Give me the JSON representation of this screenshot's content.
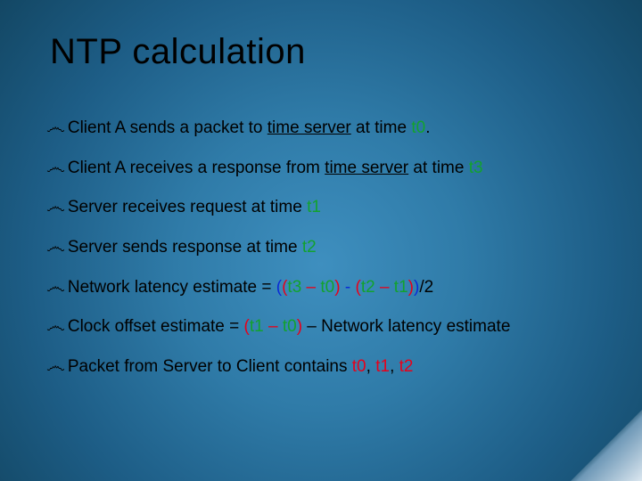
{
  "title": "NTP calculation",
  "bullets": [
    {
      "segments": [
        {
          "text": "Client A sends a packet to ",
          "cls": ""
        },
        {
          "text": "time server",
          "cls": "underline"
        },
        {
          "text": " at time ",
          "cls": ""
        },
        {
          "text": "t0",
          "cls": "hl-green"
        },
        {
          "text": ".",
          "cls": ""
        }
      ]
    },
    {
      "segments": [
        {
          "text": "Client A receives a response from ",
          "cls": ""
        },
        {
          "text": "time server",
          "cls": "underline"
        },
        {
          "text": " at time ",
          "cls": ""
        },
        {
          "text": "t3",
          "cls": "hl-green"
        }
      ]
    },
    {
      "segments": [
        {
          "text": "Server receives request at time ",
          "cls": ""
        },
        {
          "text": "t1",
          "cls": "hl-green"
        }
      ]
    },
    {
      "segments": [
        {
          "text": "Server sends response at time ",
          "cls": ""
        },
        {
          "text": "t2",
          "cls": "hl-green"
        }
      ]
    },
    {
      "segments": [
        {
          "text": "Network latency estimate = ",
          "cls": ""
        },
        {
          "text": "(",
          "cls": "hl-blue"
        },
        {
          "text": "(",
          "cls": "hl-red"
        },
        {
          "text": "t3",
          "cls": "hl-green"
        },
        {
          "text": " – ",
          "cls": "hl-red"
        },
        {
          "text": "t0",
          "cls": "hl-green"
        },
        {
          "text": ")",
          "cls": "hl-red"
        },
        {
          "text": "  - ",
          "cls": "hl-blue"
        },
        {
          "text": "(",
          "cls": "hl-red"
        },
        {
          "text": "t2",
          "cls": "hl-green"
        },
        {
          "text": " – ",
          "cls": "hl-red"
        },
        {
          "text": "t1",
          "cls": "hl-green"
        },
        {
          "text": ")",
          "cls": "hl-red"
        },
        {
          "text": ")",
          "cls": "hl-blue"
        },
        {
          "text": "/2",
          "cls": ""
        }
      ]
    },
    {
      "segments": [
        {
          "text": "Clock offset estimate = ",
          "cls": ""
        },
        {
          "text": "(",
          "cls": "hl-red"
        },
        {
          "text": "t1",
          "cls": "hl-green"
        },
        {
          "text": " – ",
          "cls": "hl-red"
        },
        {
          "text": "t0",
          "cls": "hl-green"
        },
        {
          "text": ")",
          "cls": "hl-red"
        },
        {
          "text": " – Network latency estimate",
          "cls": ""
        }
      ]
    },
    {
      "segments": [
        {
          "text": "Packet from Server to Client contains ",
          "cls": ""
        },
        {
          "text": "t0",
          "cls": "hl-red"
        },
        {
          "text": ", ",
          "cls": ""
        },
        {
          "text": "t1",
          "cls": "hl-red"
        },
        {
          "text": ", ",
          "cls": ""
        },
        {
          "text": "t2",
          "cls": "hl-red"
        }
      ]
    }
  ]
}
